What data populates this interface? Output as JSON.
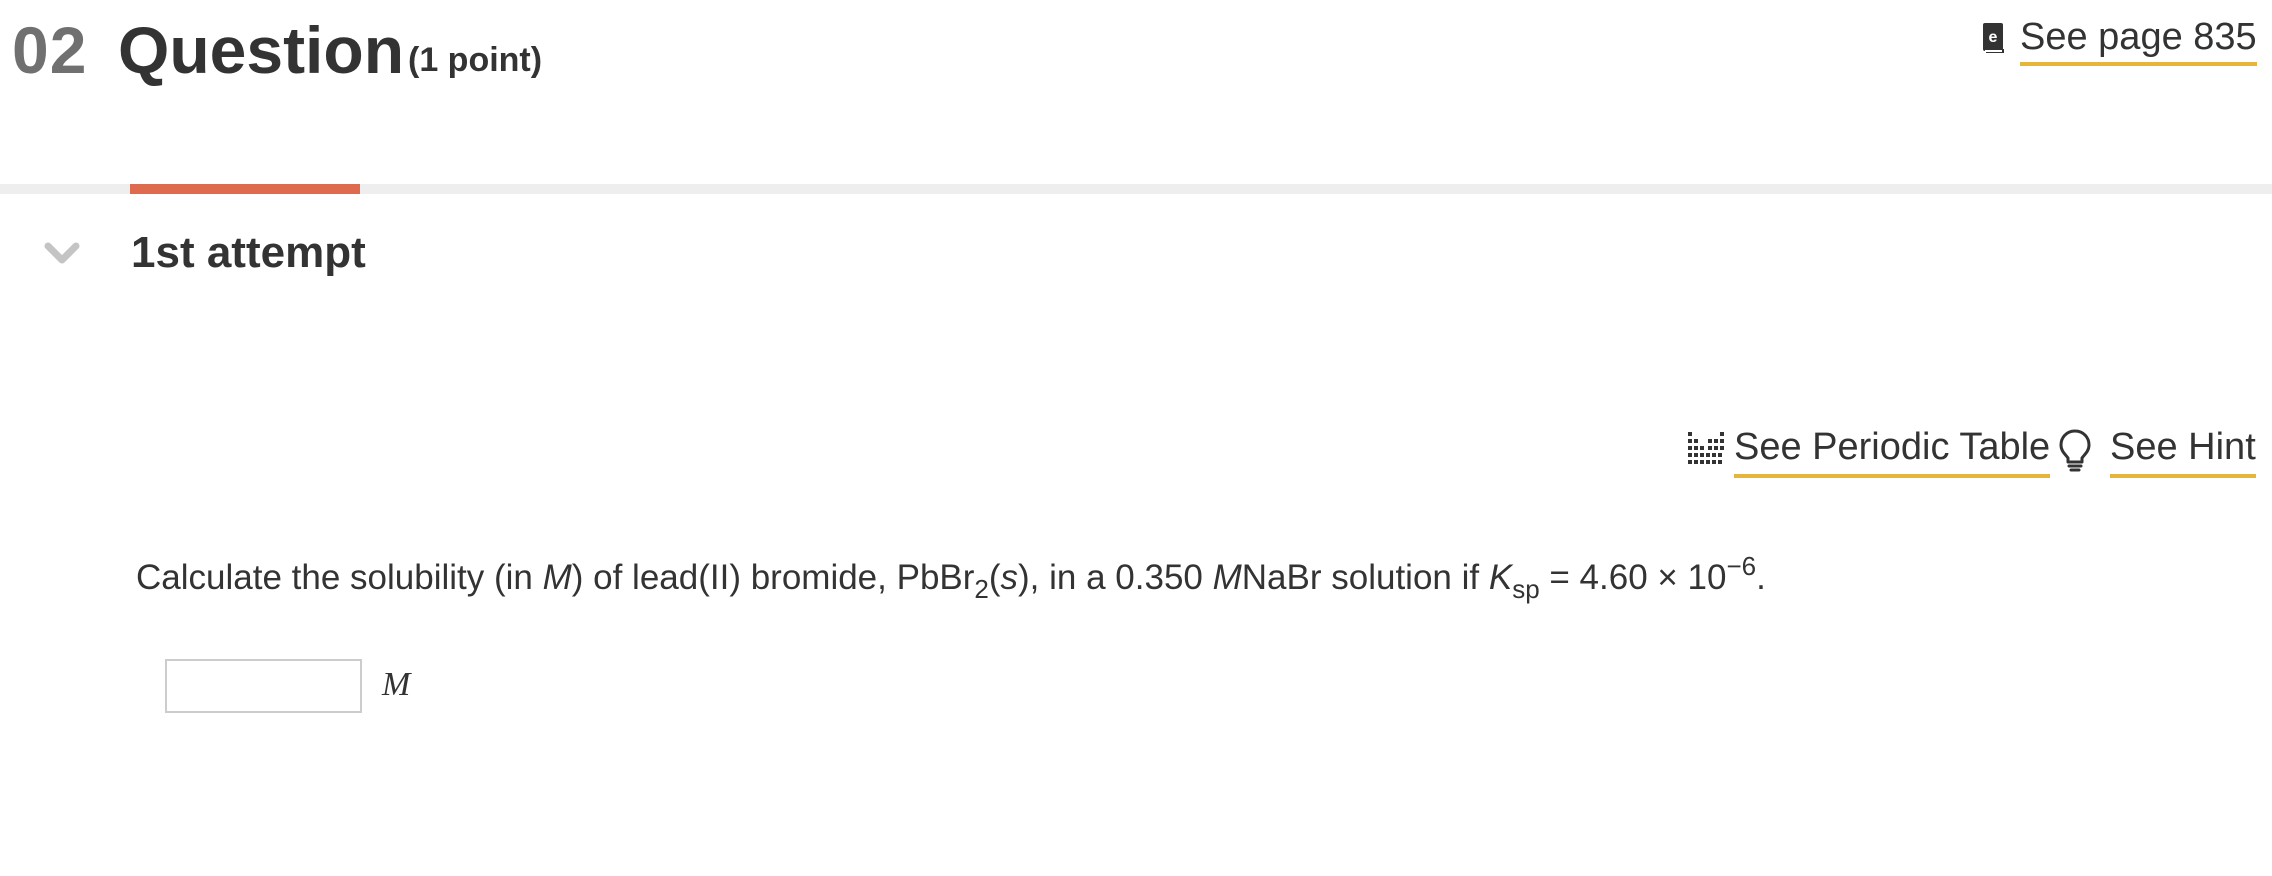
{
  "header": {
    "question_number": "02",
    "question_title": "Question",
    "points": "(1 point)",
    "see_page_label": "See page 835",
    "see_page_icon": "ebook-icon"
  },
  "attempt": {
    "label": "1st attempt",
    "tab_accent_color": "#de6b4d",
    "chevron_icon": "chevron-down-icon"
  },
  "tools": {
    "periodic_table_label": "See Periodic Table",
    "periodic_table_icon": "periodic-table-icon",
    "hint_label": "See Hint",
    "hint_icon": "lightbulb-icon",
    "link_underline_color": "#e8b53b"
  },
  "question": {
    "prompt_part1": "Calculate the solubility (in ",
    "prompt_unit_italic": "M",
    "prompt_part2": ") of lead(II) bromide, PbBr",
    "prompt_sub_2": "2",
    "prompt_part3": "(",
    "prompt_state_italic": "s",
    "prompt_part4": "), in a 0.350  ",
    "prompt_conc_unit_italic": "M",
    "prompt_part5": "NaBr solution if ",
    "prompt_k_italic": "K",
    "prompt_k_sub": "sp",
    "prompt_part6": " = 4.60 × 10",
    "prompt_exponent": "−6",
    "prompt_end": "."
  },
  "answer": {
    "value": "",
    "unit": "M"
  }
}
